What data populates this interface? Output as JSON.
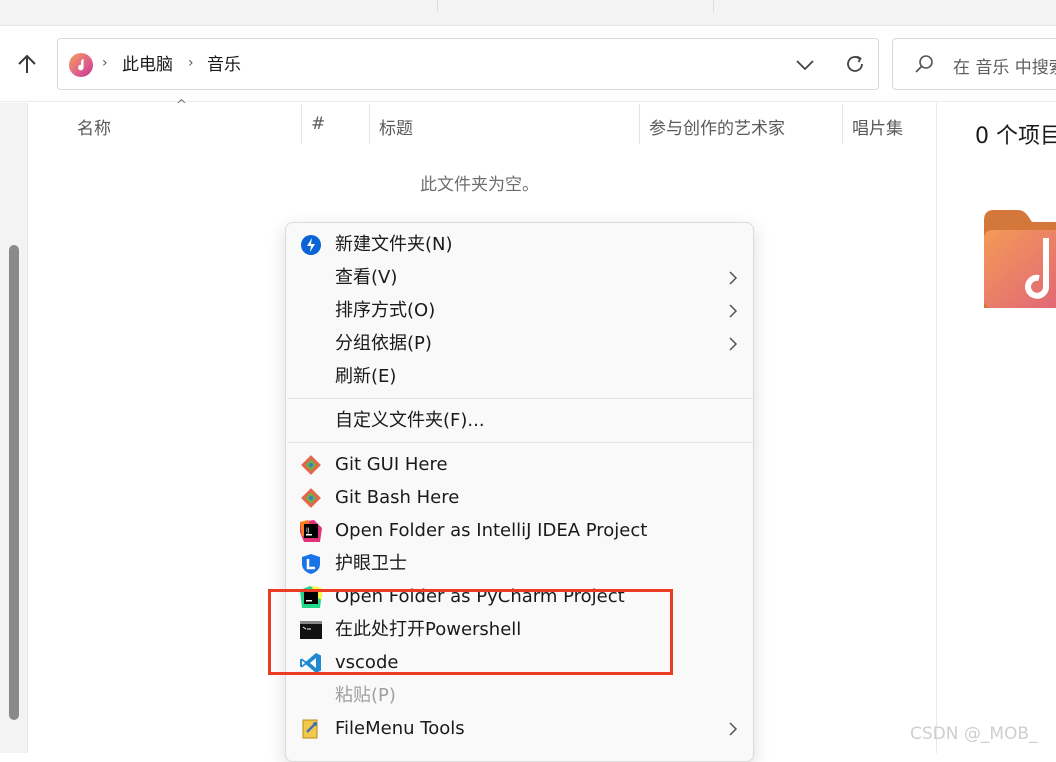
{
  "window": {
    "path": [
      "此电脑",
      "音乐"
    ],
    "search_placeholder": "在 音乐 中搜索"
  },
  "columns": {
    "name": "名称",
    "number": "#",
    "title": "标题",
    "artists": "参与创作的艺术家",
    "album": "唱片集"
  },
  "empty_message": "此文件夹为空。",
  "details": {
    "count": "0 个项目"
  },
  "context_menu": {
    "new_folder": "新建文件夹(N)",
    "view": "查看(V)",
    "sort_by": "排序方式(O)",
    "group_by": "分组依据(P)",
    "refresh": "刷新(E)",
    "customize": "自定义文件夹(F)...",
    "git_gui": "Git GUI Here",
    "git_bash": "Git Bash Here",
    "intellij": "Open Folder as IntelliJ IDEA Project",
    "eye_guard": "护眼卫士",
    "pycharm": "Open Folder as PyCharm Project",
    "powershell": "在此处打开Powershell",
    "vscode": "vscode",
    "paste": "粘贴(P)",
    "filemenu": "FileMenu Tools"
  },
  "icons": {
    "up": "arrow-up-icon",
    "music": "music-folder-icon",
    "dropdown": "chevron-down-icon",
    "refresh": "refresh-icon",
    "search": "search-icon"
  },
  "watermark": "CSDN @_MOB_",
  "colors": {
    "highlight_box": "#ea3b24",
    "accent": "#0a64d6"
  }
}
